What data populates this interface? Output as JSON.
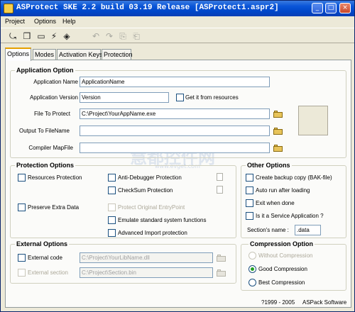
{
  "window": {
    "title": "ASProtect SKE 2.2 build 03.19 Release [ASProtect1.aspr2]"
  },
  "menu": [
    "Project",
    "Options",
    "Help"
  ],
  "toolbar": [
    "open-icon",
    "save-icon",
    "new-icon",
    "build-icon",
    "test-icon",
    "undo-icon",
    "redo-icon",
    "copy-icon",
    "paste-icon"
  ],
  "tabs": [
    "Options",
    "Modes",
    "Activation Keys",
    "Protection"
  ],
  "app_option": {
    "legend": "Application Option",
    "name_label": "Application Name",
    "name_value": "ApplicationName",
    "version_label": "Application Version",
    "version_value": "Version",
    "get_resources_label": "Get it from resources",
    "file_protect_label": "File To Protect",
    "file_protect_value": "C:\\Project\\YourAppName.exe",
    "output_label": "Output To FileName",
    "output_value": "",
    "mapfile_label": "Compiler MapFile",
    "mapfile_value": ""
  },
  "protection_options": {
    "legend": "Protection Options",
    "resources": "Resources Protection",
    "anti_debugger": "Anti-Debugger Protection",
    "checksum": "CheckSum Protection",
    "preserve": "Preserve Extra Data",
    "protect_ep": "Protect Original EntryPoint",
    "emulate": "Emulate standard system functions",
    "advanced_import": "Advanced Import protection"
  },
  "other_options": {
    "legend": "Other Options",
    "backup": "Create backup copy (BAK-file)",
    "autorun": "Auto run after loading",
    "exit": "Exit when done",
    "service": "Is it a Service Application ?",
    "section_label": "Section's name :",
    "section_value": ".data"
  },
  "external_options": {
    "legend": "External Options",
    "code_label": "External code",
    "code_value": "C:\\Project\\YourLibName.dll",
    "section_label": "External section",
    "section_value": "C:\\Project\\Section.bin"
  },
  "compression": {
    "legend": "Compression Option",
    "without": "Without Compression",
    "good": "Good Compression",
    "best": "Best Compression",
    "selected": "Good Compression"
  },
  "footer": {
    "copyright": "?1999 - 2005",
    "company": "ASPack Software"
  },
  "watermark": {
    "main": "慧都控件网",
    "url": "www.evget.com"
  },
  "colors": {
    "title_bar": "#0a55d8",
    "window_bg": "#ece9d8",
    "tab_accent": "#e5a000"
  }
}
